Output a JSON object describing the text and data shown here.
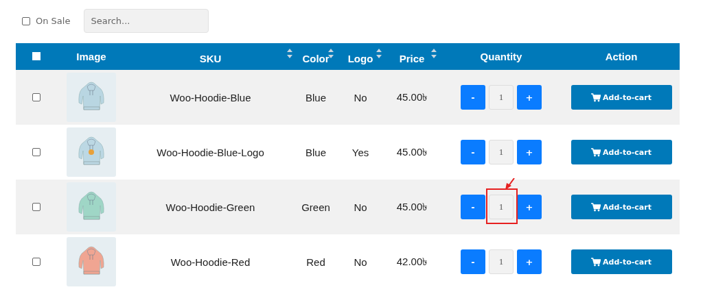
{
  "filter": {
    "on_sale": {
      "label": "On Sale",
      "checked": false
    },
    "search": {
      "placeholder": "Search..."
    }
  },
  "table": {
    "select_all": {
      "checked": false
    },
    "columns": [
      {
        "label": "Image",
        "sortable": false
      },
      {
        "label": "SKU",
        "sortable": true
      },
      {
        "label": "Color",
        "sortable": true
      },
      {
        "label": "Logo",
        "sortable": true
      },
      {
        "label": "Price",
        "sortable": true
      },
      {
        "label": "Quantity",
        "sortable": false
      },
      {
        "label": "Action",
        "sortable": false
      }
    ],
    "rows": [
      {
        "checked": false,
        "sku": "Woo-Hoodie-Blue",
        "color_name": "Blue",
        "logo": "No",
        "price": "45.00৳",
        "minus": "-",
        "quantity": "1",
        "plus": "+",
        "action": "Add-to-cart",
        "highlighted": false
      },
      {
        "checked": false,
        "sku": "Woo-Hoodie-Blue-Logo",
        "color_name": "Blue",
        "logo": "Yes",
        "price": "45.00৳",
        "minus": "-",
        "quantity": "1",
        "plus": "+",
        "action": "Add-to-cart",
        "highlighted": false
      },
      {
        "checked": false,
        "sku": "Woo-Hoodie-Green",
        "color_name": "Green",
        "logo": "No",
        "price": "45.00৳",
        "minus": "-",
        "quantity": "1",
        "plus": "+",
        "action": "Add-to-cart",
        "highlighted": true
      },
      {
        "checked": false,
        "sku": "Woo-Hoodie-Red",
        "color_name": "Red",
        "logo": "No",
        "price": "42.00৳",
        "minus": "-",
        "quantity": "1",
        "plus": "+",
        "action": "Add-to-cart",
        "highlighted": false
      }
    ]
  }
}
